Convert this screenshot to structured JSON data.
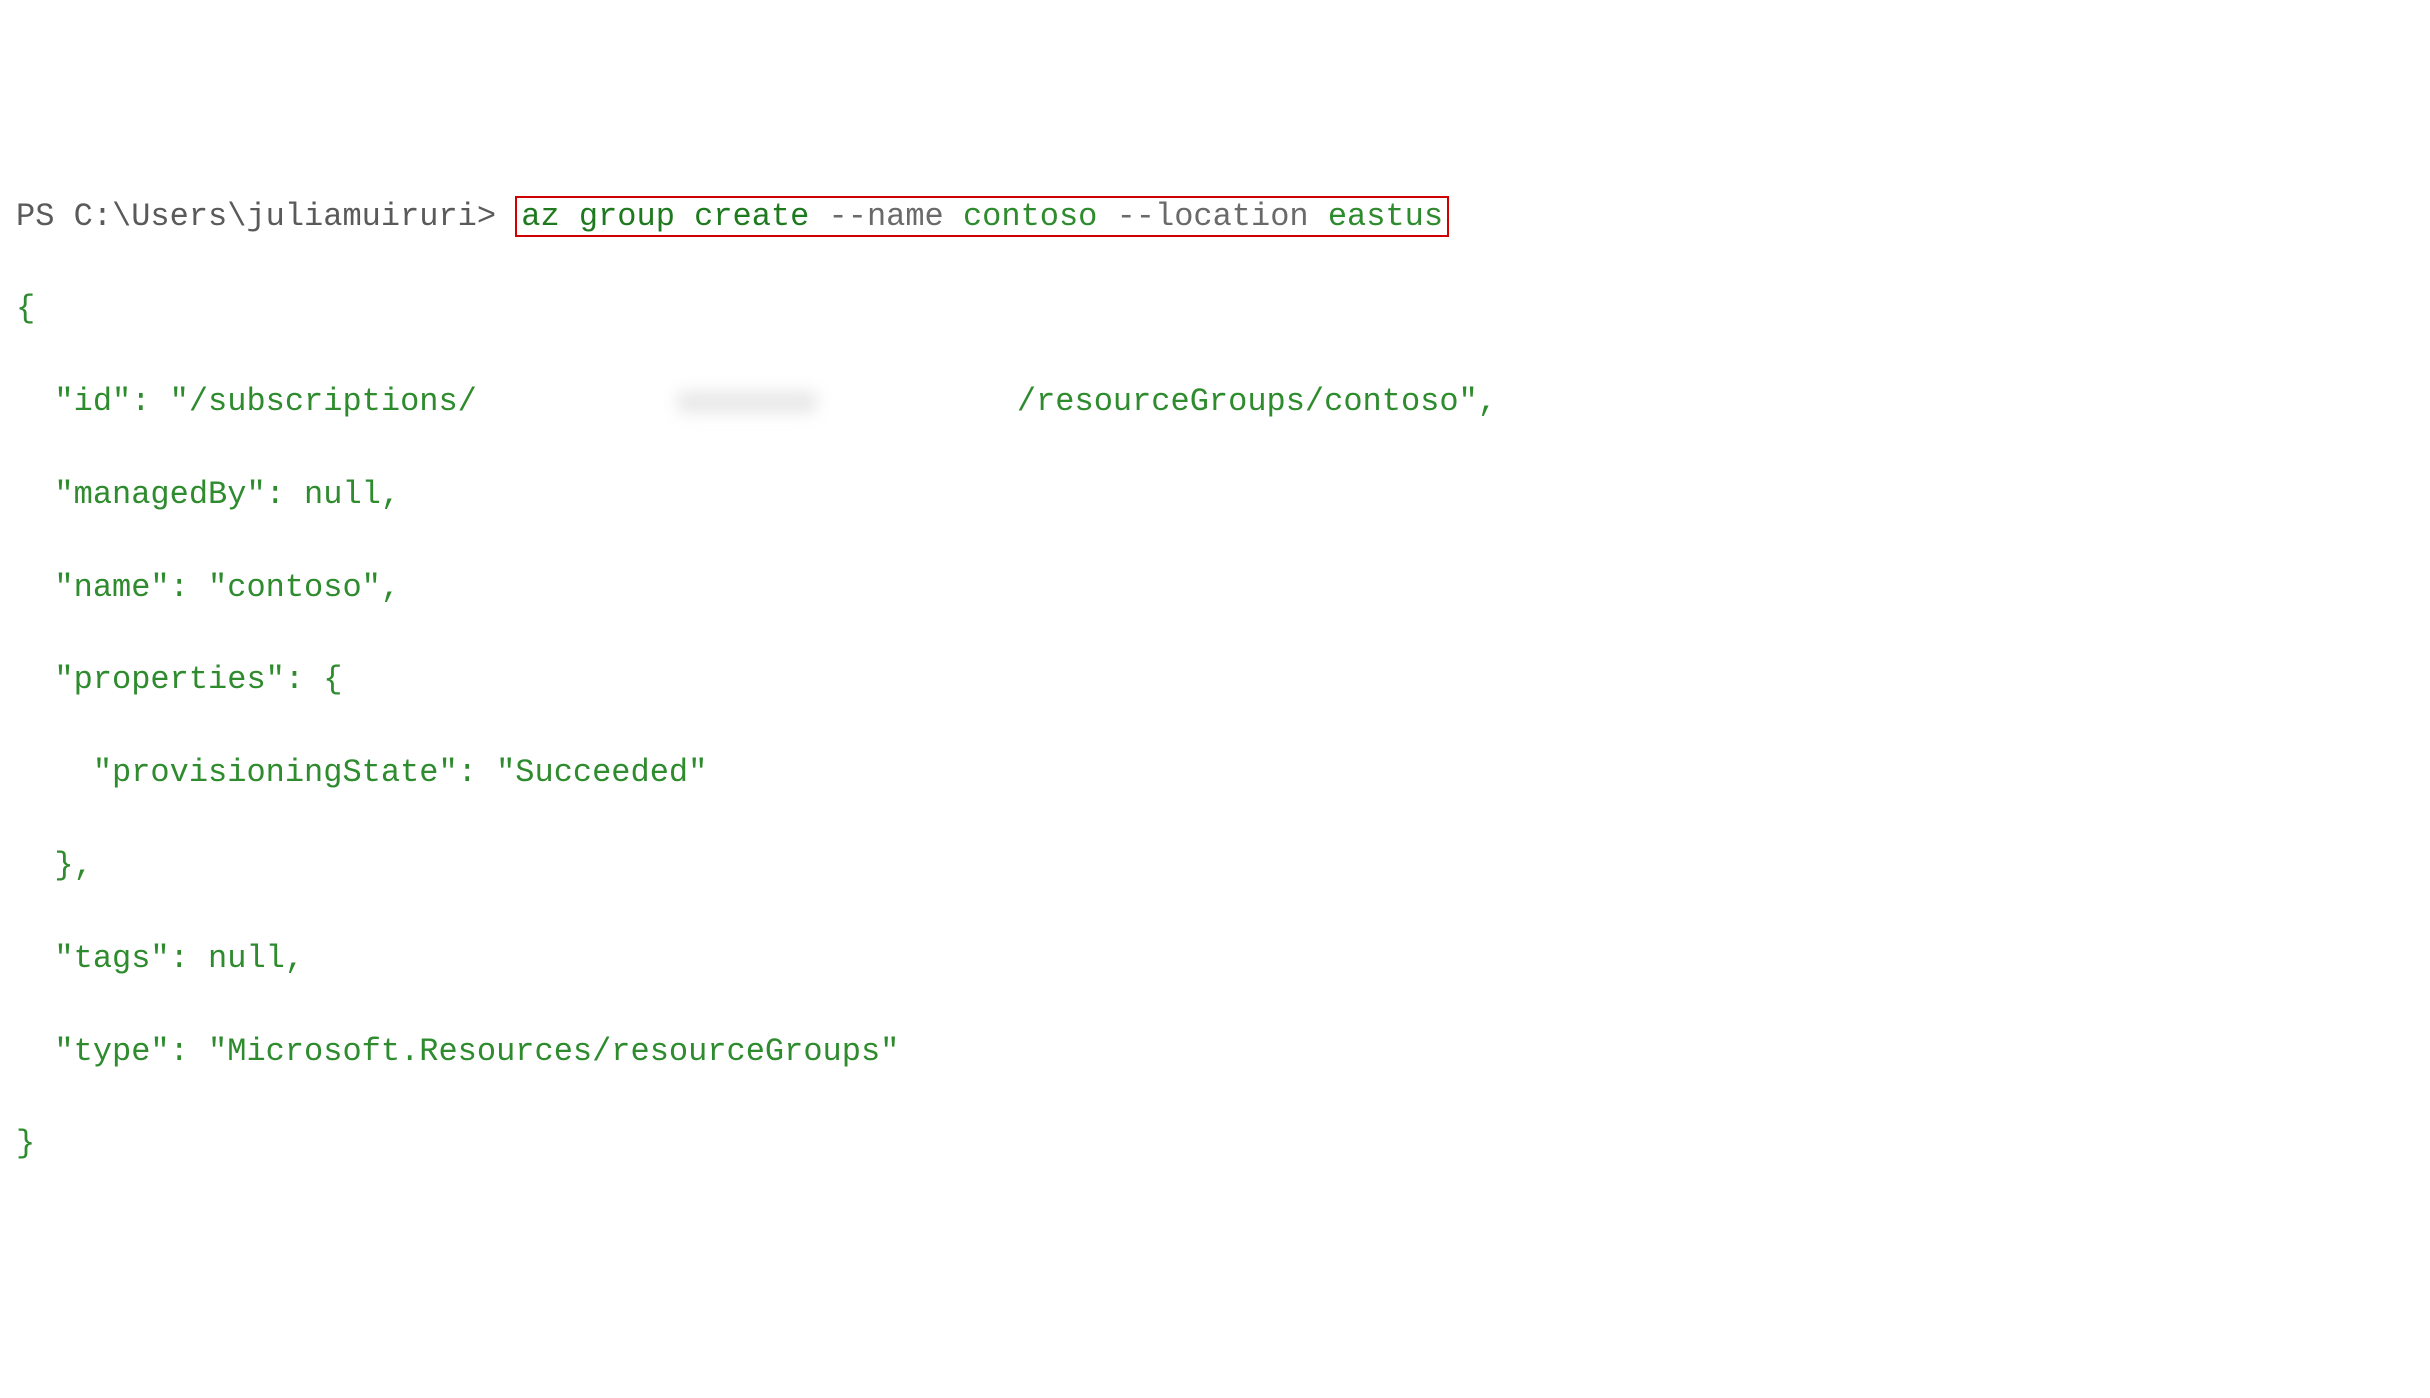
{
  "prompt": {
    "shell": "PS",
    "path": "C:\\Users\\juliamuiruri",
    "caret": ">"
  },
  "command": {
    "tokens": [
      {
        "text": "az",
        "kind": "cmd"
      },
      {
        "text": "group",
        "kind": "cmd"
      },
      {
        "text": "create",
        "kind": "cmd"
      },
      {
        "text": "--name",
        "kind": "flag"
      },
      {
        "text": "contoso",
        "kind": "arg"
      },
      {
        "text": "--location",
        "kind": "flag"
      },
      {
        "text": "eastus",
        "kind": "arg"
      }
    ]
  },
  "output": {
    "open_brace": "{",
    "close_brace": "}",
    "id_key": "  \"id\": \"/subscriptions/",
    "id_suffix": "/resourceGroups/contoso\",",
    "managedBy": "  \"managedBy\": null,",
    "name": "  \"name\": \"contoso\",",
    "properties_open": "  \"properties\": {",
    "provisioningState": "    \"provisioningState\": \"Succeeded\"",
    "properties_close": "  },",
    "tags": "  \"tags\": null,",
    "type": "  \"type\": \"Microsoft.Resources/resourceGroups\""
  }
}
